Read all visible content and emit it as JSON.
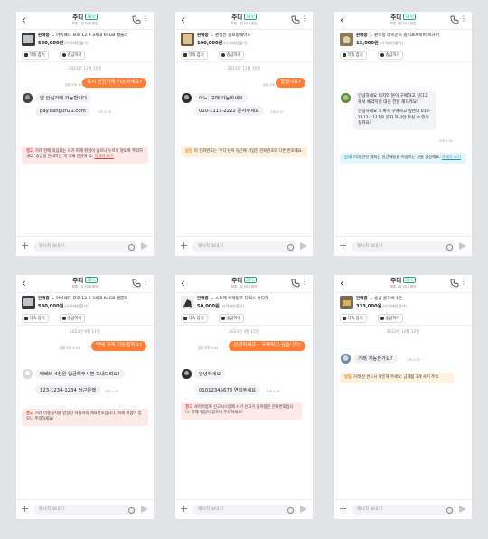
{
  "common": {
    "seller_name": "주디",
    "temperature": "38℃",
    "header_sub": "보통 1분 이내 응답",
    "action_promise": "약속 잡기",
    "action_remit": "송금하기",
    "input_placeholder": "메시지 보내기",
    "seller_label": "판매중",
    "price_suffix": "(가격제안불가)"
  },
  "screens": [
    {
      "product_title": "아이패드 프로 12.9 3세대 64GB 셀룰러",
      "product_price": "580,000원",
      "date": "2023년 11월 15일",
      "my_message": "혹시 안전거래 가능하세요?",
      "read_status": "읽음 오후 4:44",
      "their_messages": [
        {
          "text": "넵 안심거래 가능합니다",
          "time": "오후 4:45"
        },
        {
          "text": "pay.danguri21.com",
          "time": "오후 4:45"
        }
      ],
      "notice_type": "warn",
      "notice_label": "경고",
      "notice_text": "거래 전에 의심되는 사기 피해 위험이 높으니 누르지 않도록 주의하세요. 송금을 안내하는 게 거래 안전에 요.",
      "notice_link": "자세히 보기"
    },
    {
      "product_title": "편성한 골프펌웨어드",
      "product_price": "100,000원",
      "date": "2023년 11월 15일",
      "my_message": "팔렸나요?",
      "read_status": "읽음 오후 4:44",
      "their_messages": [
        {
          "text": "아뇨, 구매 가능하세요",
          "time": "오후 4:47"
        },
        {
          "text": "010-1111-2222 문자주세요",
          "time": "오후 4:47"
        }
      ],
      "notice_type": "caution",
      "notice_label": "알림",
      "notice_text": "이 전화번호는 '주디'님이 당근에 가입한 전화번호와 다른 번호에요."
    },
    {
      "product_title": "편오랑 라이운즈 릴리프트비버 피규어",
      "product_price": "13,000원",
      "their_intro": "안녕하세요 티지역 분이 구매하고 싶다고 해서 예약지만 대신 전달 해드려요!",
      "their_intro2": "안녕하세요 :) 혹시 구매하고 싶은데 010-1111-1111로 문자 하나만 주실 수 있으실까요?",
      "their_time": "오후 4:45",
      "notice_type": "info",
      "notice_label": "안내",
      "notice_text": "거래 관련 대화는 당근채팅을 이용하는 것을 권장해요.",
      "notice_link": "자세히 보기"
    },
    {
      "product_title": "아이패드 프로 12.9 3세대 64GB 셀룰러",
      "product_price": "580,000원",
      "date": "2023년 9월 11일",
      "my_message": "택배 거래 가능할까요?",
      "read_status": "읽음 오후 4:44",
      "their_messages": [
        {
          "text": "택배비 4천원 입금해주시면 보내드려요!",
          "time": "오후 4:45"
        },
        {
          "text": "123-1234-1234 당근은행",
          "time": "오후 4:45"
        }
      ],
      "notice_type": "warn",
      "notice_label": "경고",
      "notice_text": "거래 이용정지를 받았던 사용자의 계좌번호입니다. 피해 위험이 있으니 주의하세요!"
    },
    {
      "product_title": "스토케 트레일즈 디럭스 유모차",
      "product_price": "50,000원",
      "date": "2023년 4월 15일",
      "my_message": "안녕하세요~ 구매하고 싶습니다!",
      "read_status": "읽음 오후 4:44",
      "their_messages": [
        {
          "text": "안녕하세요",
          "time": "오후 4:45"
        },
        {
          "text": "01012345678 연락주세요",
          "time": "오후 4:45"
        }
      ],
      "notice_type": "warn",
      "notice_label": "경고",
      "notice_text": "사이버범죄 신고시스템에 사기 신고가 들어왔던 전화번호입니다. 피해 위험이 있으니 주의하세요!"
    },
    {
      "product_title": "송금 골드바 1돈",
      "product_price": "333,000원",
      "date": "2023년 10월 12일",
      "their_messages": [
        {
          "text": "거래 가능한가요?",
          "time": "오후 4:45"
        }
      ],
      "notice_type": "caution",
      "notice_label": "알림",
      "notice_text": "거래 전 반드시 확인해 주세요: 금제품 3개 사기 주의"
    }
  ]
}
